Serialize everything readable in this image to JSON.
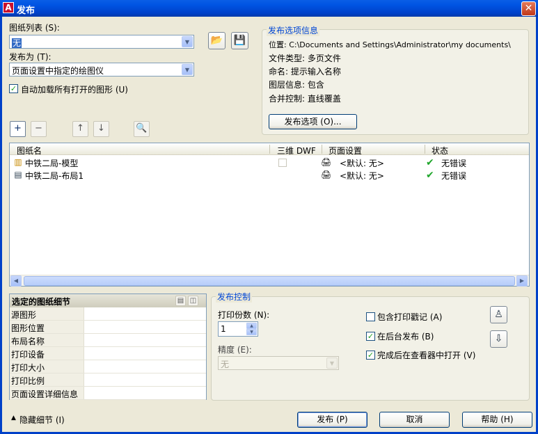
{
  "window": {
    "title": "发布",
    "app_icon": "A",
    "close_glyph": "✕"
  },
  "sheet_list": {
    "label": "图纸列表 (S):",
    "value": "无",
    "arrow": "▼"
  },
  "publish_to": {
    "label": "发布为 (T):",
    "value": "页面设置中指定的绘图仪",
    "arrow": "▼"
  },
  "auto_load": {
    "label": "自动加载所有打开的图形 (U)",
    "checked": "✓"
  },
  "icons": {
    "load_sheet_list": "📂",
    "save_sheet_list": "💾",
    "add_sheets": "+",
    "remove_sheets": "−",
    "move_up": "↑",
    "move_down": "↓",
    "preview": "🔍",
    "plot_stamp": "♙",
    "publish_options_icon": "⇩",
    "details_btn1": "▤",
    "details_btn2": "◫",
    "ok": "✔",
    "sheet_model": "▥",
    "sheet_layout": "▤",
    "page_setup": "🖨"
  },
  "publish_info": {
    "title": "发布选项信息",
    "location": "位置: C:\\Documents and Settings\\Administrator\\my documents\\",
    "file_type": "文件类型: 多页文件",
    "naming": "命名: 提示输入名称",
    "layer_info": "图层信息: 包含",
    "merge_control": "合并控制: 直线覆盖",
    "options_button": "发布选项 (O)..."
  },
  "sheets_table": {
    "columns": [
      "图纸名",
      "三维 DWF",
      "页面设置",
      "状态"
    ],
    "rows": [
      {
        "name": "中铁二局-模型",
        "page_setup": "<默认: 无>",
        "status": "无错误"
      },
      {
        "name": "中铁二局-布局1",
        "page_setup": "<默认: 无>",
        "status": "无错误"
      }
    ],
    "scroll_left": "◀",
    "scroll_right": "▶"
  },
  "details": {
    "title": "选定的图纸细节",
    "rows": [
      "源图形",
      "图形位置",
      "布局名称",
      "打印设备",
      "打印大小",
      "打印比例",
      "页面设置详细信息"
    ]
  },
  "publish_control": {
    "title": "发布控制",
    "copies_label": "打印份数 (N):",
    "copies_value": "1",
    "precision_label": "精度 (E):",
    "precision_value": "无",
    "include_stamp": "包含打印戳记 (A)",
    "background": "在后台发布 (B)",
    "open_viewer": "完成后在查看器中打开 (V)",
    "checked": "✓",
    "spin_up": "▲",
    "spin_down": "▼",
    "arrow": "▼"
  },
  "footer": {
    "hide_details": "隐藏细节 (I)",
    "triangle": "▲",
    "publish": "发布 (P)",
    "cancel": "取消",
    "help": "帮助 (H)"
  }
}
